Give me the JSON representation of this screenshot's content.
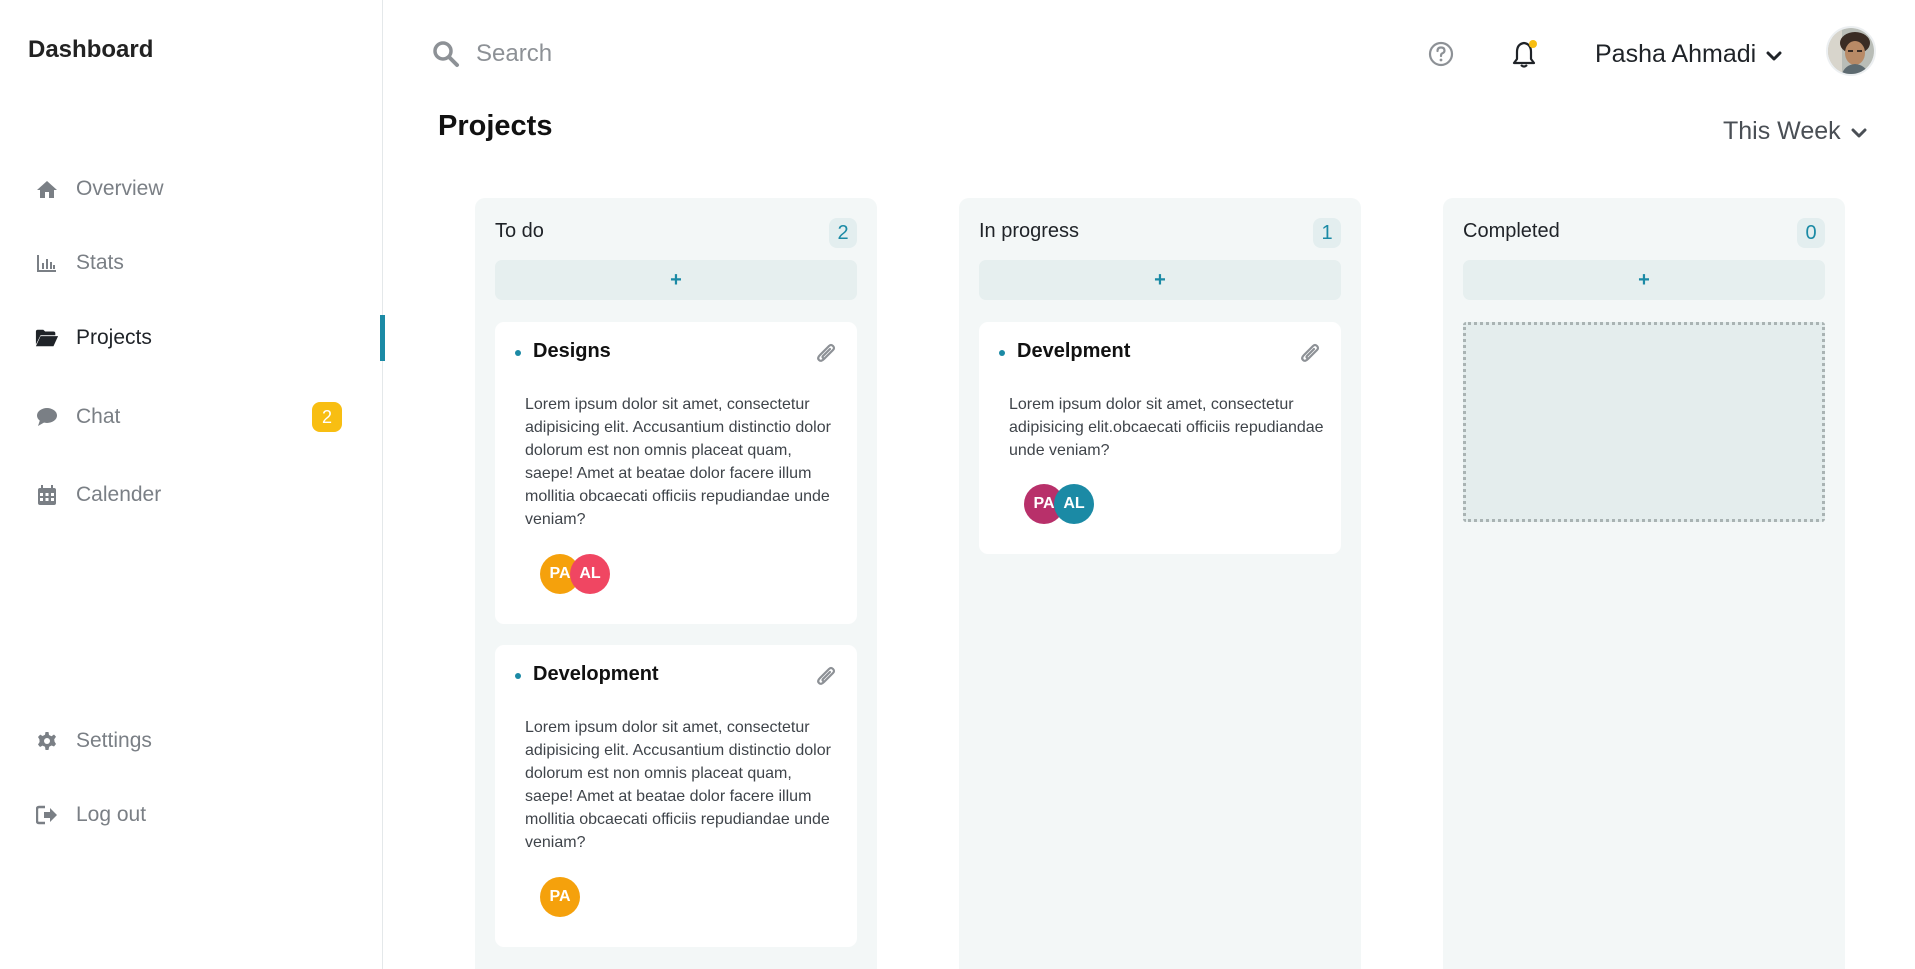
{
  "brand": "Dashboard",
  "sidebar": {
    "items": [
      {
        "label": "Overview",
        "icon": "home-icon"
      },
      {
        "label": "Stats",
        "icon": "bar-chart-icon"
      },
      {
        "label": "Projects",
        "icon": "folder-open-icon"
      },
      {
        "label": "Chat",
        "icon": "chat-bubble-icon",
        "badge": "2"
      },
      {
        "label": "Calender",
        "icon": "calendar-icon"
      }
    ],
    "bottom_items": [
      {
        "label": "Settings",
        "icon": "gear-icon"
      },
      {
        "label": "Log out",
        "icon": "logout-icon"
      }
    ]
  },
  "search": {
    "placeholder": "Search"
  },
  "user": {
    "name": "Pasha Ahmadi"
  },
  "page": {
    "title": "Projects",
    "period": "This Week"
  },
  "colors": {
    "accent": "#1b8aa5",
    "badge": "#f8be12",
    "column_bg": "#f3f7f7"
  },
  "board": {
    "columns": [
      {
        "title": "To do",
        "count": "2",
        "add_label": "+",
        "cards": [
          {
            "title": "Designs",
            "text": "Lorem ipsum dolor sit amet, consectetur adipisicing elit. Accusantium distinctio dolor dolorum est non omnis placeat quam, saepe! Amet at beatae dolor facere illum mollitia obcaecati officiis repudiandae unde veniam?",
            "avatars": [
              {
                "initials": "PA",
                "color": "#f5a10c"
              },
              {
                "initials": "AL",
                "color": "#f04662"
              }
            ]
          },
          {
            "title": "Development",
            "text": "Lorem ipsum dolor sit amet, consectetur adipisicing elit. Accusantium distinctio dolor dolorum est non omnis placeat quam, saepe! Amet at beatae dolor facere illum mollitia obcaecati officiis repudiandae unde veniam?",
            "avatars": [
              {
                "initials": "PA",
                "color": "#f5a10c"
              }
            ]
          }
        ]
      },
      {
        "title": "In progress",
        "count": "1",
        "add_label": "+",
        "cards": [
          {
            "title": "Develpment",
            "text": "Lorem ipsum dolor sit amet, consectetur adipisicing elit.obcaecati officiis repudiandae unde veniam?",
            "avatars": [
              {
                "initials": "PA",
                "color": "#b8306a"
              },
              {
                "initials": "AL",
                "color": "#1b8aa5"
              }
            ]
          }
        ]
      },
      {
        "title": "Completed",
        "count": "0",
        "add_label": "+",
        "cards": []
      }
    ]
  }
}
